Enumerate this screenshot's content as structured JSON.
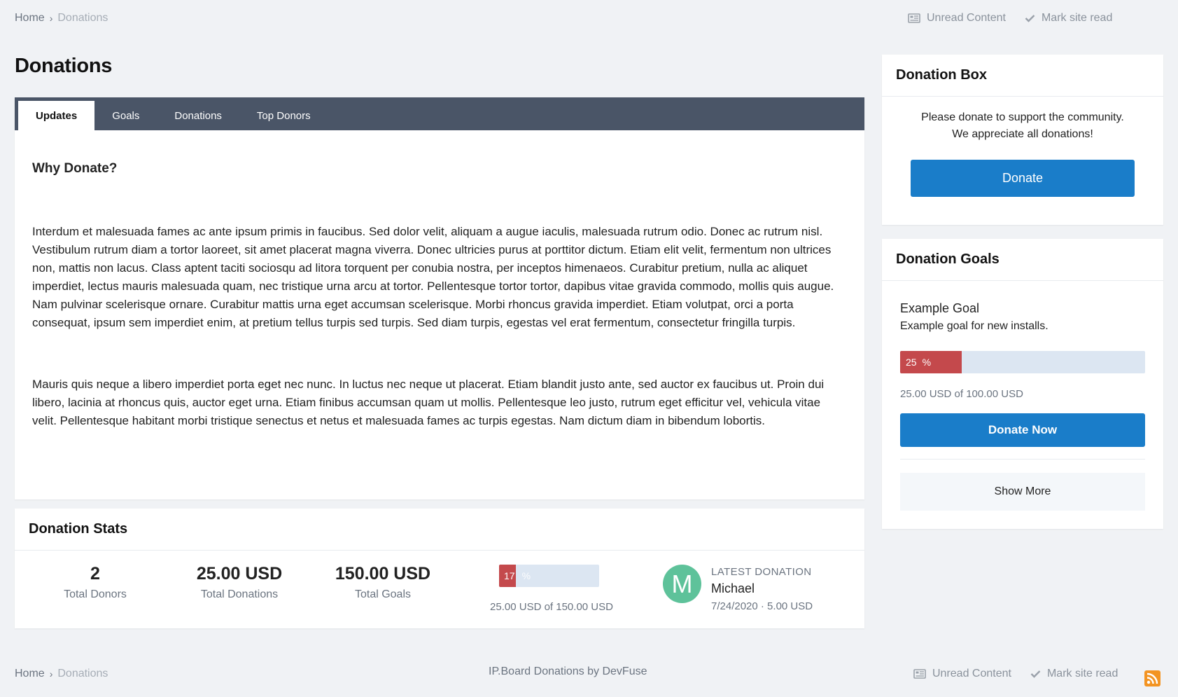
{
  "breadcrumb": {
    "home": "Home",
    "separator": "›",
    "current": "Donations"
  },
  "toplinks": {
    "unread": "Unread Content",
    "mark_read": "Mark site read"
  },
  "page_title": "Donations",
  "tabs": [
    {
      "label": "Updates",
      "active": true
    },
    {
      "label": "Goals",
      "active": false
    },
    {
      "label": "Donations",
      "active": false
    },
    {
      "label": "Top Donors",
      "active": false
    }
  ],
  "updates": {
    "heading": "Why Donate?",
    "paragraph1": "Interdum et malesuada fames ac ante ipsum primis in faucibus. Sed dolor velit, aliquam a augue iaculis, malesuada rutrum odio. Donec ac rutrum nisl. Vestibulum rutrum diam a tortor laoreet, sit amet placerat magna viverra. Donec ultricies purus at porttitor dictum. Etiam elit velit, fermentum non ultrices non, mattis non lacus. Class aptent taciti sociosqu ad litora torquent per conubia nostra, per inceptos himenaeos. Curabitur pretium, nulla ac aliquet imperdiet, lectus mauris malesuada quam, nec tristique urna arcu at tortor. Pellentesque tortor tortor, dapibus vitae gravida commodo, mollis quis augue. Nam pulvinar scelerisque ornare. Curabitur mattis urna eget accumsan scelerisque. Morbi rhoncus gravida imperdiet. Etiam volutpat, orci a porta consequat, ipsum sem imperdiet enim, at pretium tellus turpis sed turpis. Sed diam turpis, egestas vel erat fermentum, consectetur fringilla turpis.",
    "paragraph2": "Mauris quis neque a libero imperdiet porta eget nec nunc. In luctus nec neque ut placerat. Etiam blandit justo ante, sed auctor ex faucibus ut. Proin dui libero, lacinia at rhoncus quis, auctor eget urna. Etiam finibus accumsan quam ut mollis. Pellentesque leo justo, rutrum eget efficitur vel, vehicula vitae velit. Pellentesque habitant morbi tristique senectus et netus et malesuada fames ac turpis egestas. Nam dictum diam in bibendum lobortis."
  },
  "stats": {
    "title": "Donation Stats",
    "total_donors": "2",
    "total_donors_label": "Total Donors",
    "total_donations": "25.00 USD",
    "total_donations_label": "Total Donations",
    "total_goals": "150.00 USD",
    "total_goals_label": "Total Goals",
    "progress_value": 17,
    "progress_number": "17",
    "progress_pct_sign": "%",
    "progress_caption": "25.00 USD of 150.00 USD",
    "latest_caption": "LATEST DONATION",
    "latest_initial": "M",
    "latest_name": "Michael",
    "latest_meta": "7/24/2020 · 5.00 USD",
    "avatar_color": "#5ec29a"
  },
  "donation_box": {
    "title": "Donation Box",
    "message_line1": "Please donate to support the community.",
    "message_line2": "We appreciate all donations!",
    "button": "Donate"
  },
  "goals": {
    "title": "Donation Goals",
    "goal_name": "Example Goal",
    "goal_desc": "Example goal for new installs.",
    "progress_value": 25,
    "progress_number": "25",
    "progress_pct_sign": "%",
    "amount": "25.00 USD of 100.00 USD",
    "button": "Donate Now",
    "show_more": "Show More"
  },
  "footer": {
    "credit": "IP.Board Donations by DevFuse"
  },
  "colors": {
    "accent": "#1a7dc9",
    "progress_fill": "#c4494c",
    "progress_track": "#dce6f2",
    "tabbar": "#4a5567",
    "rss": "#f39422"
  },
  "icons": [
    "unread-content-icon",
    "checkmark-icon",
    "rss-icon",
    "chevron-right-icon"
  ]
}
